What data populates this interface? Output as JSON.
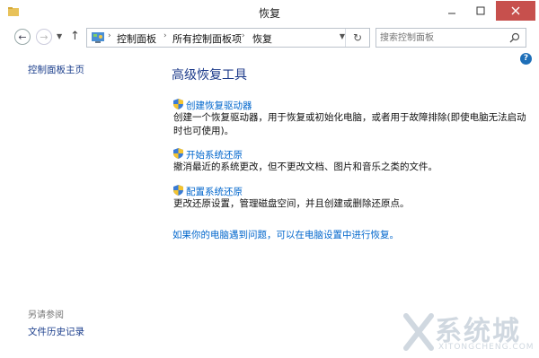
{
  "window": {
    "title": "恢复"
  },
  "breadcrumb": [
    "控制面板",
    "所有控制面板项",
    "恢复"
  ],
  "search": {
    "placeholder": "搜索控制面板"
  },
  "sidebar": {
    "home_link": "控制面板主页",
    "see_also_label": "另请参阅",
    "file_history_link": "文件历史记录"
  },
  "main": {
    "title": "高级恢复工具",
    "tasks": [
      {
        "label": "创建恢复驱动器",
        "description": "创建一个恢复驱动器，用于恢复或初始化电脑，或者用于故障排除(即使电脑无法启动时也可使用)。"
      },
      {
        "label": "开始系统还原",
        "description": "撤消最近的系统更改，但不更改文档、图片和音乐之类的文件。"
      },
      {
        "label": "配置系统还原",
        "description": "更改还原设置，管理磁盘空间，并且创建或删除还原点。"
      }
    ],
    "bottom_link": "如果你的电脑遇到问题，可以在电脑设置中进行恢复。"
  },
  "watermark": {
    "brand": "系统城",
    "sub": "XITONGCHENG.COM"
  },
  "colors": {
    "link": "#0066cc",
    "title": "#1c3a8a",
    "close": "#c7504d"
  }
}
